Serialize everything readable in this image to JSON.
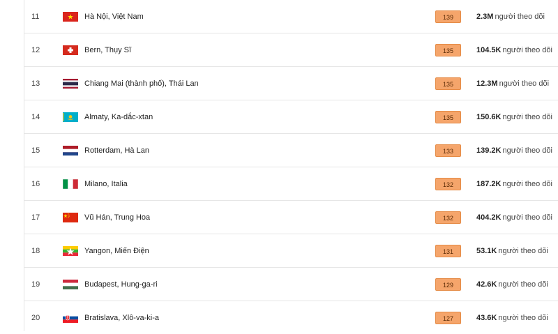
{
  "rows": [
    {
      "rank": "11",
      "flag": "vietnam-flag-icon",
      "city": "Hà Nội, Việt Nam",
      "score": "139",
      "followers": "2.3M",
      "followers_label": "người theo dõi"
    },
    {
      "rank": "12",
      "flag": "switzerland-flag-icon",
      "city": "Bern, Thụy Sĩ",
      "score": "135",
      "followers": "104.5K",
      "followers_label": "người theo dõi"
    },
    {
      "rank": "13",
      "flag": "thailand-flag-icon",
      "city": "Chiang Mai (thành phố), Thái Lan",
      "score": "135",
      "followers": "12.3M",
      "followers_label": "người theo dõi"
    },
    {
      "rank": "14",
      "flag": "kazakhstan-flag-icon",
      "city": "Almaty, Ka-dắc-xtan",
      "score": "135",
      "followers": "150.6K",
      "followers_label": "người theo dõi"
    },
    {
      "rank": "15",
      "flag": "netherlands-flag-icon",
      "city": "Rotterdam, Hà Lan",
      "score": "133",
      "followers": "139.2K",
      "followers_label": "người theo dõi"
    },
    {
      "rank": "16",
      "flag": "italy-flag-icon",
      "city": "Milano, Italia",
      "score": "132",
      "followers": "187.2K",
      "followers_label": "người theo dõi"
    },
    {
      "rank": "17",
      "flag": "china-flag-icon",
      "city": "Vũ Hán, Trung Hoa",
      "score": "132",
      "followers": "404.2K",
      "followers_label": "người theo dõi"
    },
    {
      "rank": "18",
      "flag": "myanmar-flag-icon",
      "city": "Yangon, Miến Điện",
      "score": "131",
      "followers": "53.1K",
      "followers_label": "người theo dõi"
    },
    {
      "rank": "19",
      "flag": "hungary-flag-icon",
      "city": "Budapest, Hung-ga-ri",
      "score": "129",
      "followers": "42.6K",
      "followers_label": "người theo dõi"
    },
    {
      "rank": "20",
      "flag": "slovakia-flag-icon",
      "city": "Bratislava, Xlô-va-ki-a",
      "score": "127",
      "followers": "43.6K",
      "followers_label": "người theo dõi"
    }
  ],
  "colors": {
    "score_badge": "#f5a56b",
    "score_border": "#e58b46"
  }
}
